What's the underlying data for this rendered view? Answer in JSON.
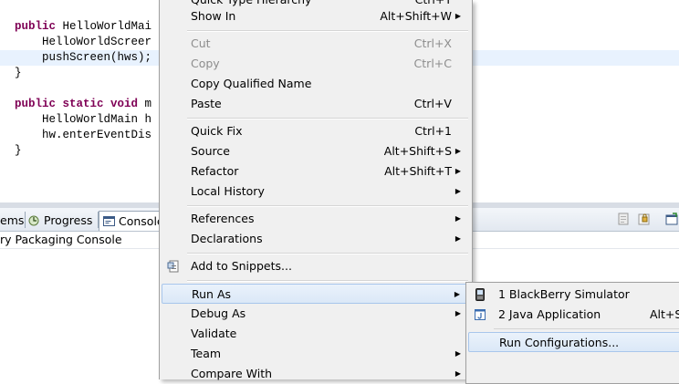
{
  "editor": {
    "lines": [
      {
        "kw": "public ",
        "text": "HelloWorldMai"
      },
      {
        "kw": "",
        "text": "    HelloWorldScreer"
      },
      {
        "kw": "",
        "text": "    pushScreen(hws);"
      },
      {
        "kw": "",
        "text": "}"
      },
      {
        "kw": "",
        "text": ""
      },
      {
        "kw": "public static void ",
        "text": "m"
      },
      {
        "kw": "",
        "text": "    HelloWorldMain h"
      },
      {
        "kw": "",
        "text": "    hw.enterEventDis"
      },
      {
        "kw": "",
        "text": "}"
      }
    ]
  },
  "views": {
    "tabs": {
      "problems": "ems",
      "progress": "Progress",
      "console": "Console"
    },
    "console_title": "ry Packaging Console"
  },
  "context_menu": {
    "quick_type_hierarchy": "Quick Type Hierarchy",
    "quick_type_shortcut": "Ctrl+T",
    "show_in": "Show In",
    "show_in_shortcut": "Alt+Shift+W",
    "cut": "Cut",
    "cut_shortcut": "Ctrl+X",
    "copy": "Copy",
    "copy_shortcut": "Ctrl+C",
    "copy_qualified_name": "Copy Qualified Name",
    "paste": "Paste",
    "paste_shortcut": "Ctrl+V",
    "quick_fix": "Quick Fix",
    "quick_fix_shortcut": "Ctrl+1",
    "source": "Source",
    "source_shortcut": "Alt+Shift+S",
    "refactor": "Refactor",
    "refactor_shortcut": "Alt+Shift+T",
    "local_history": "Local History",
    "references": "References",
    "declarations": "Declarations",
    "add_to_snippets": "Add to Snippets...",
    "run_as": "Run As",
    "debug_as": "Debug As",
    "validate": "Validate",
    "team": "Team",
    "compare_with": "Compare With"
  },
  "run_as_submenu": {
    "blackberry_simulator": "1 BlackBerry Simulator",
    "java_application": "2 Java Application",
    "java_application_shortcut": "Alt+Sl",
    "run_configurations": "Run Configurations..."
  },
  "colors": {
    "keyword": "#7f0055",
    "menu_bg": "#f0f0f0",
    "highlight_border": "#a8c6ec",
    "current_line": "#e8f2fe"
  }
}
